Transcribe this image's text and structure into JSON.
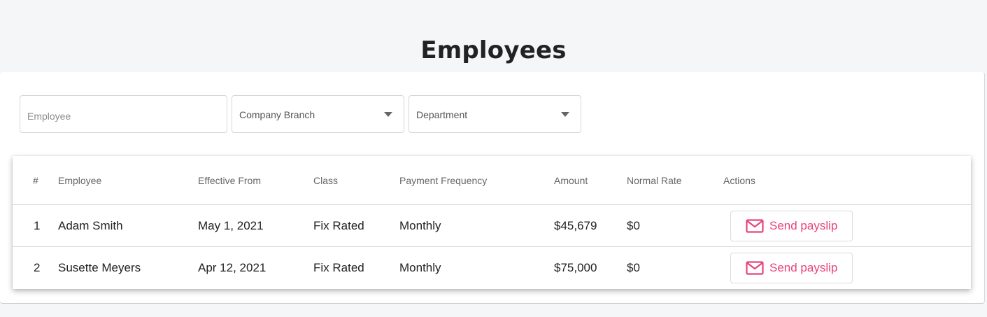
{
  "page": {
    "title": "Employees"
  },
  "filters": {
    "employee_placeholder": "Employee",
    "branch_label": "Company Branch",
    "department_label": "Department"
  },
  "table": {
    "headers": [
      "#",
      "Employee",
      "Effective From",
      "Class",
      "Payment Frequency",
      "Amount",
      "Normal Rate",
      "Actions"
    ],
    "rows": [
      {
        "num": "1",
        "employee": "Adam Smith",
        "effective_from": "May 1, 2021",
        "class": "Fix Rated",
        "frequency": "Monthly",
        "amount": "$45,679",
        "normal_rate": "$0",
        "action_label": "Send payslip"
      },
      {
        "num": "2",
        "employee": "Susette Meyers",
        "effective_from": "Apr 12, 2021",
        "class": "Fix Rated",
        "frequency": "Monthly",
        "amount": "$75,000",
        "normal_rate": "$0",
        "action_label": "Send payslip"
      }
    ]
  },
  "colors": {
    "link": "#2a7ae2",
    "action": "#e8437a"
  },
  "icons": {
    "action_icon": "mail-icon",
    "select_icon": "caret-down-icon"
  }
}
